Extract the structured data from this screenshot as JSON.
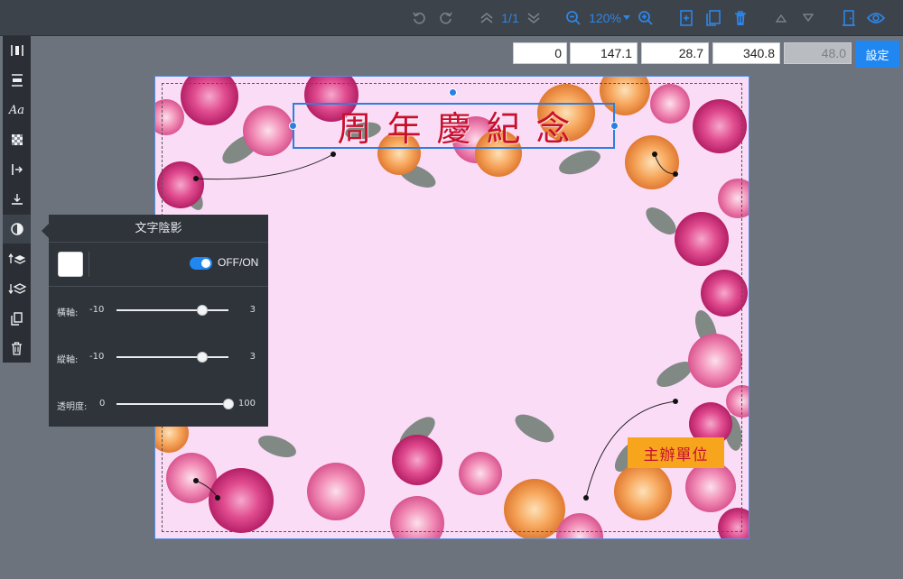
{
  "toolbar": {
    "page_indicator": "1/1",
    "zoom_level": "120%",
    "icons": [
      "undo-icon",
      "redo-icon",
      "page-up-icon",
      "page-down-icon",
      "zoom-out-icon",
      "zoom-dropdown-icon",
      "zoom-in-icon",
      "add-page-icon",
      "duplicate-page-icon",
      "delete-page-icon",
      "move-up-icon",
      "move-down-icon",
      "exit-icon",
      "preview-eye-icon"
    ],
    "accent": "#2d86e6"
  },
  "coords": {
    "values": [
      "0",
      "147.1",
      "28.7",
      "340.8",
      "48.0"
    ],
    "set_button": "設定"
  },
  "left_tools": [
    "align-horizontal-icon",
    "align-vertical-icon",
    "font-icon",
    "transparency-icon",
    "move-right-icon",
    "move-down-icon",
    "shadow-icon",
    "bring-forward-icon",
    "send-backward-icon",
    "copy-icon",
    "trash-icon"
  ],
  "canvas": {
    "title": "周年慶紀念",
    "host_label": "主辦單位",
    "background": "#fbdcf7"
  },
  "shadow_panel": {
    "title": "文字陰影",
    "swatch_color": "#ffffff",
    "toggle_label": "OFF/ON",
    "toggle_on": true,
    "sliders": [
      {
        "label": "橫軸:",
        "min": "-10",
        "max": "3",
        "min_value": -10,
        "max_value": 3,
        "value": 0
      },
      {
        "label": "縱軸:",
        "min": "-10",
        "max": "3",
        "min_value": -10,
        "max_value": 3,
        "value": 0
      },
      {
        "label": "透明度:",
        "min": "0",
        "max": "100",
        "min_value": 0,
        "max_value": 100,
        "value": 100
      }
    ]
  }
}
